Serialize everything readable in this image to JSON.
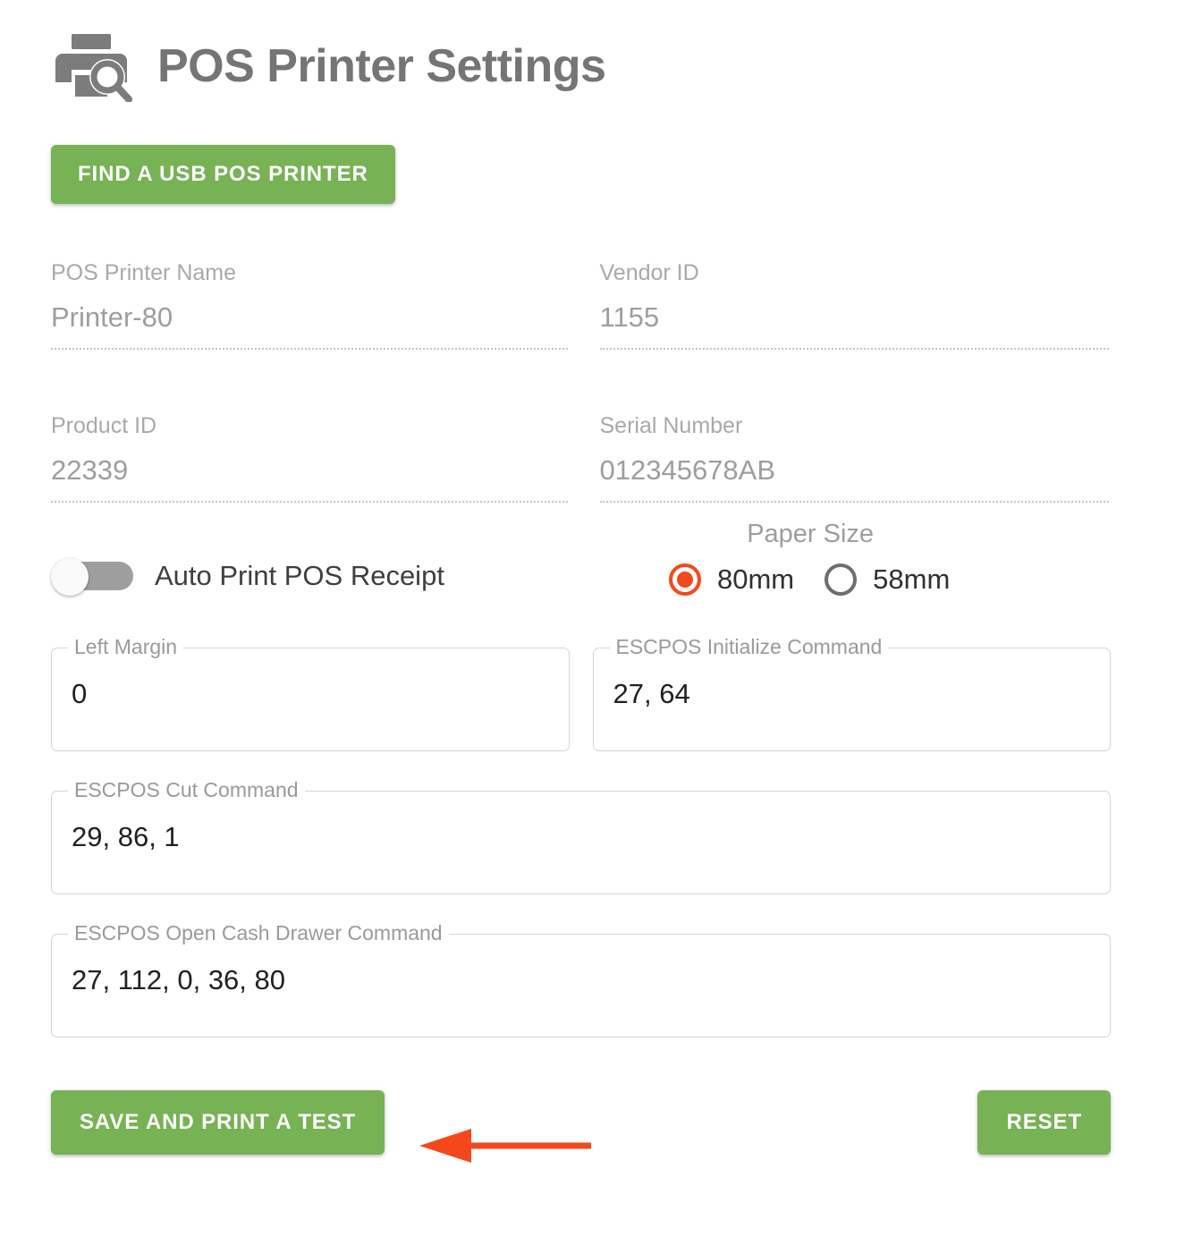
{
  "header": {
    "title": "POS Printer Settings",
    "icon": "printer-search-icon"
  },
  "actions": {
    "find_printer_label": "FIND A USB POS PRINTER",
    "save_label": "SAVE AND PRINT A TEST",
    "reset_label": "RESET"
  },
  "info_fields": [
    {
      "label": "POS Printer Name",
      "value": "Printer-80"
    },
    {
      "label": "Vendor ID",
      "value": "1155"
    },
    {
      "label": "Product ID",
      "value": "22339"
    },
    {
      "label": "Serial Number",
      "value": "012345678AB"
    }
  ],
  "auto_print": {
    "label": "Auto Print POS Receipt",
    "checked": false
  },
  "paper_size": {
    "title": "Paper Size",
    "selected": "80mm",
    "options": [
      {
        "label": "80mm",
        "checked": true
      },
      {
        "label": "58mm",
        "checked": false
      }
    ]
  },
  "command_fields": [
    {
      "label": "Left Margin",
      "value": "0"
    },
    {
      "label": "ESCPOS Initialize Command",
      "value": "27, 64"
    },
    {
      "label": "ESCPOS Cut Command",
      "value": "29, 86, 1"
    },
    {
      "label": "ESCPOS Open Cash Drawer Command",
      "value": "27, 112, 0, 36, 80"
    }
  ],
  "annotation": {
    "type": "arrow-left",
    "points_to": "SAVE AND PRINT A TEST",
    "color": "#f4481c"
  },
  "colors": {
    "green_button": "#77b255",
    "accent_radio": "#f4481c",
    "title_gray": "#757575",
    "label_gray": "#a9a9a9"
  }
}
